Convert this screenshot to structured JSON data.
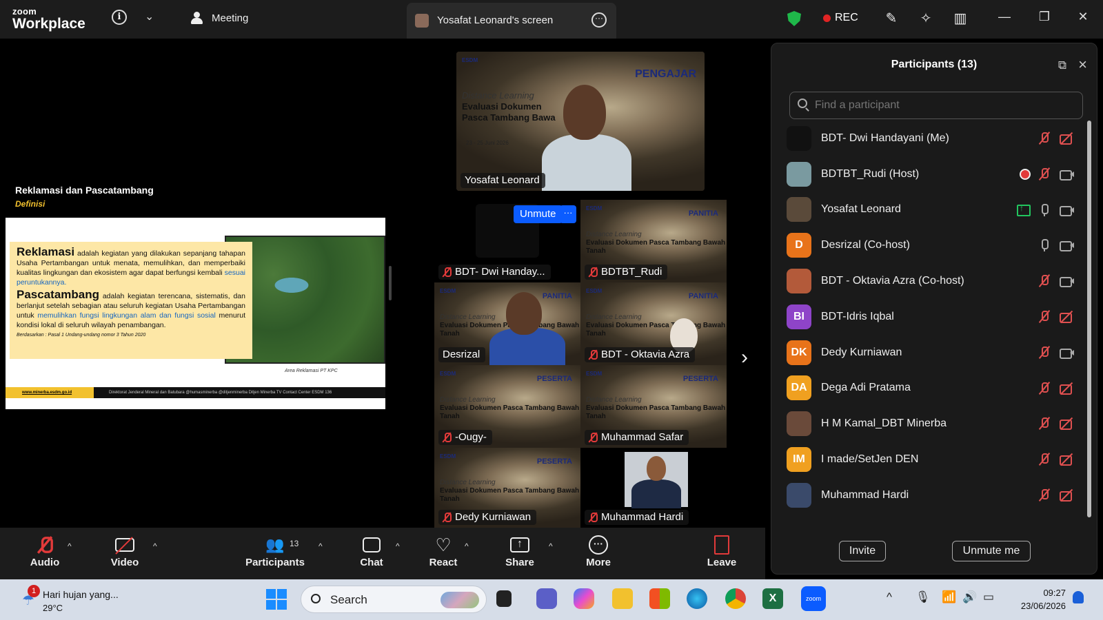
{
  "app": {
    "logo_top": "zoom",
    "logo_bottom": "Workplace",
    "meeting_label": "Meeting",
    "screen_tab_title": "Yosafat Leonard's screen",
    "rec_label": "REC"
  },
  "slide": {
    "title": "Reklamasi dan Pascatambang",
    "subtitle": "Definisi",
    "reklamasi_term": "Reklamasi",
    "reklamasi_text": "adalah kegiatan yang dilakukan sepanjang tahapan Usaha Pertambangan untuk menata, memulihkan, dan memperbaiki kualitas lingkungan dan ekosistem agar dapat berfungsi kembali",
    "reklamasi_highlight": "sesuai peruntukannya.",
    "pasca_term": "Pascatambang",
    "pasca_text_1": "adalah kegiatan terencana, sistematis, dan berlanjut setelah sebagian atau seluruh kegiatan Usaha Pertambangan untuk",
    "pasca_highlight": "memulihkan fungsi lingkungan alam dan fungsi sosial",
    "pasca_text_2": "menurut kondisi lokal di seluruh wilayah penambangan.",
    "source": "Berdasarkan : Pasal 1 Undang-undang nomor 3 Tahun 2020",
    "photo_caption": "Area Reklamasi PT KPC",
    "footer_url": "www.minerba.esdm.go.id",
    "footer_right": "Direktorat Jenderal Mineral dan Batubara    @humasminerba    @ditjenminerba    Ditjen Minerba TV    Contact Center ESDM 136"
  },
  "tiles": {
    "speaker": {
      "name": "Yosafat Leonard",
      "tag": "PENGAJAR",
      "course_it": "Distance Learning",
      "course": "Evaluasi Dokumen Pasca Tambang Bawa",
      "date": "23 - 25 Juni 2026",
      "org": "ESDM"
    },
    "self": {
      "name": "BDT- Dwi Handay...",
      "unmute": "Unmute",
      "more": "···"
    },
    "rudi": {
      "name": "BDTBT_Rudi",
      "tag": "PANITIA"
    },
    "desrizal": {
      "name": "Desrizal",
      "tag": "PANITIA"
    },
    "oktavia": {
      "name": "BDT - Oktavia Azra",
      "tag": "PANITIA"
    },
    "ougy": {
      "name": "-Ougy-",
      "tag": "PESERTA"
    },
    "safar": {
      "name": "Muhammad Safar",
      "tag": "PESERTA"
    },
    "dedy": {
      "name": "Dedy Kurniawan",
      "tag": "PESERTA"
    },
    "hardi": {
      "name": "Muhammad Hardi"
    },
    "course_it": "Distance Learning",
    "course": "Evaluasi Dokumen Pasca Tambang Bawah Tanah",
    "org": "ESDM"
  },
  "panel": {
    "title": "Participants (13)",
    "search_placeholder": "Find a participant",
    "invite": "Invite",
    "unmute_me": "Unmute me",
    "participants": [
      {
        "name": "BDT- Dwi Handayani (Me)",
        "initials": "",
        "color": "#111111",
        "mic": "off",
        "cam": "off"
      },
      {
        "name": "BDTBT_Rudi (Host)",
        "initials": "",
        "color": "#7a9aa0",
        "mic": "off",
        "cam": "on",
        "rec": true
      },
      {
        "name": "Yosafat Leonard",
        "initials": "",
        "color": "#5a4a3a",
        "mic": "on",
        "cam": "on",
        "share": true
      },
      {
        "name": "Desrizal (Co-host)",
        "initials": "D",
        "color": "#e8731a",
        "mic": "on",
        "cam": "on"
      },
      {
        "name": "BDT - Oktavia Azra (Co-host)",
        "initials": "",
        "color": "#b35a3a",
        "mic": "off",
        "cam": "on"
      },
      {
        "name": "BDT-Idris Iqbal",
        "initials": "BI",
        "color": "#8e44c8",
        "mic": "off",
        "cam": "off"
      },
      {
        "name": "Dedy Kurniawan",
        "initials": "DK",
        "color": "#e8731a",
        "mic": "off",
        "cam": "on"
      },
      {
        "name": "Dega Adi Pratama",
        "initials": "DA",
        "color": "#f0a020",
        "mic": "off",
        "cam": "off"
      },
      {
        "name": "H M Kamal_DBT Minerba",
        "initials": "",
        "color": "#6a4a3a",
        "mic": "off",
        "cam": "off"
      },
      {
        "name": "I made/SetJen DEN",
        "initials": "IM",
        "color": "#f0a020",
        "mic": "off",
        "cam": "off"
      },
      {
        "name": "Muhammad Hardi",
        "initials": "",
        "color": "#3a4a6a",
        "mic": "off",
        "cam": "off"
      }
    ]
  },
  "toolbar": {
    "audio": "Audio",
    "video": "Video",
    "participants": "Participants",
    "participants_count": "13",
    "chat": "Chat",
    "react": "React",
    "share": "Share",
    "more": "More",
    "leave": "Leave"
  },
  "taskbar": {
    "weather_badge": "1",
    "weather_text": "Hari hujan yang...",
    "temperature": "29°C",
    "search": "Search",
    "time": "09:27",
    "date": "23/06/2026"
  }
}
